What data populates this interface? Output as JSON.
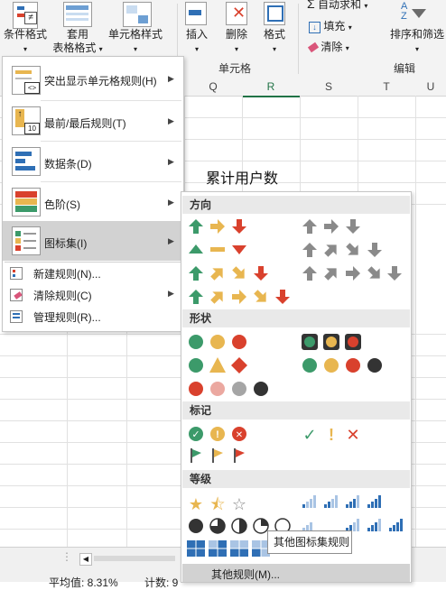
{
  "ribbon": {
    "conditional_format": "条件格式",
    "table_format_1": "套用",
    "table_format_2": "表格格式",
    "cell_style": "单元格样式",
    "insert": "插入",
    "delete": "删除",
    "format": "格式",
    "group_cells": "单元格",
    "autosum": "自动求和",
    "fill": "填充",
    "clear": "清除",
    "sort_filter": "排序和筛选",
    "group_edit": "编辑"
  },
  "columns": [
    "Q",
    "R",
    "S",
    "T",
    "U"
  ],
  "cell_text": "累计用户数",
  "menu": {
    "items": [
      {
        "label": "突出显示单元格规则(H)",
        "icon": "highlight-rules-icon"
      },
      {
        "label": "最前/最后规则(T)",
        "icon": "top-bottom-icon"
      },
      {
        "label": "数据条(D)",
        "icon": "data-bars-icon"
      },
      {
        "label": "色阶(S)",
        "icon": "color-scales-icon"
      },
      {
        "label": "图标集(I)",
        "icon": "icon-sets-icon"
      },
      {
        "label": "新建规则(N)...",
        "icon": "new-rule-icon"
      },
      {
        "label": "清除规则(C)",
        "icon": "clear-rules-icon"
      },
      {
        "label": "管理规则(R)...",
        "icon": "manage-rules-icon"
      }
    ]
  },
  "submenu": {
    "sections": [
      "方向",
      "形状",
      "标记",
      "等级"
    ],
    "tooltip": "其他图标集规则",
    "more_rules": "其他规则(M)..."
  },
  "status": {
    "average": "平均值: 8.31%",
    "count": "计数: 9"
  },
  "colors": {
    "green": "#3c9a6a",
    "yellow": "#e8b650",
    "red": "#d9412d",
    "gray": "#8a8a8a",
    "blue": "#2f6fb5"
  }
}
